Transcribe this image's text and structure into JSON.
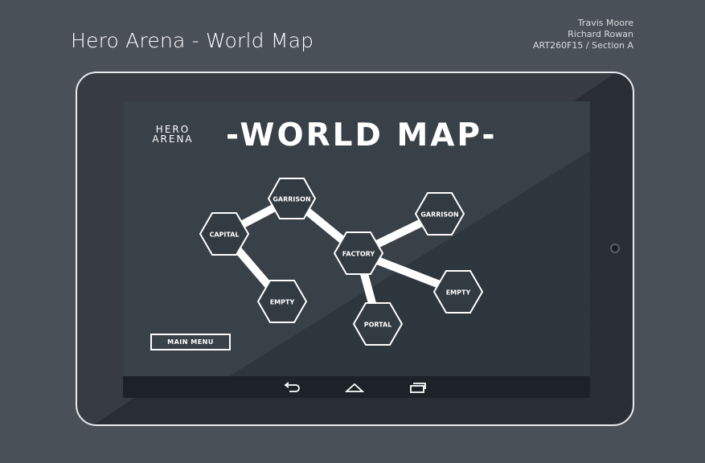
{
  "header": {
    "title": "Hero Arena - World Map",
    "credits": [
      "Travis Moore",
      "Richard Rowan",
      "ART260F15 / Section A"
    ]
  },
  "screen": {
    "logo_line1": "HERO",
    "logo_line2": "ARENA",
    "heading": "-WORLD MAP-",
    "main_menu_label": "MAIN MENU"
  },
  "map": {
    "nodes": [
      "GARRISON",
      "CAPITAL",
      "EMPTY",
      "FACTORY",
      "GARRISON",
      "EMPTY",
      "PORTAL"
    ],
    "connections": [
      [
        "CAPITAL",
        "GARRISON"
      ],
      [
        "CAPITAL",
        "EMPTY"
      ],
      [
        "GARRISON",
        "FACTORY"
      ],
      [
        "FACTORY",
        "GARRISON"
      ],
      [
        "FACTORY",
        "EMPTY"
      ],
      [
        "FACTORY",
        "PORTAL"
      ]
    ]
  },
  "navbar": {
    "icons": [
      "back-icon",
      "home-icon",
      "recent-apps-icon"
    ]
  },
  "colors": {
    "background": "#4a5058",
    "tablet_body": "#2b3137",
    "screen": "#323a42",
    "navbar": "#1c2227",
    "foreground": "#ffffff"
  }
}
